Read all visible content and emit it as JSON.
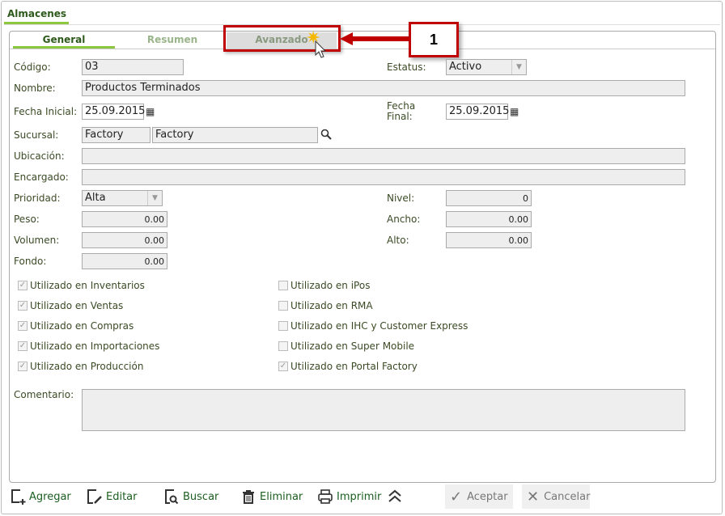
{
  "window_tab": "Almacenes",
  "tabs": [
    "General",
    "Resumen",
    "Avanzado"
  ],
  "callout": "1",
  "fields": {
    "codigo": {
      "label": "Código:",
      "value": "03"
    },
    "estatus": {
      "label": "Estatus:",
      "value": "Activo"
    },
    "nombre": {
      "label": "Nombre:",
      "value": "Productos Terminados"
    },
    "fecha_inicial": {
      "label": "Fecha Inicial:",
      "value": "25.09.2015"
    },
    "fecha_final": {
      "label": "Fecha Final:",
      "value": "25.09.2015"
    },
    "sucursal": {
      "label": "Sucursal:",
      "code": "Factory",
      "name": "Factory"
    },
    "ubicacion": {
      "label": "Ubicación:",
      "value": ""
    },
    "encargado": {
      "label": "Encargado:",
      "value": ""
    },
    "prioridad": {
      "label": "Prioridad:",
      "value": "Alta"
    },
    "nivel": {
      "label": "Nivel:",
      "value": "0"
    },
    "peso": {
      "label": "Peso:",
      "value": "0.00"
    },
    "ancho": {
      "label": "Ancho:",
      "value": "0.00"
    },
    "volumen": {
      "label": "Volumen:",
      "value": "0.00"
    },
    "alto": {
      "label": "Alto:",
      "value": "0.00"
    },
    "fondo": {
      "label": "Fondo:",
      "value": "0.00"
    },
    "comentario": {
      "label": "Comentario:",
      "value": ""
    }
  },
  "checks_left": [
    {
      "label": "Utilizado en Inventarios",
      "checked": true
    },
    {
      "label": "Utilizado en Ventas",
      "checked": true
    },
    {
      "label": "Utilizado en Compras",
      "checked": true
    },
    {
      "label": "Utilizado en Importaciones",
      "checked": true
    },
    {
      "label": "Utilizado en Producción",
      "checked": true
    }
  ],
  "checks_right": [
    {
      "label": "Utilizado en iPos",
      "checked": false
    },
    {
      "label": "Utilizado en RMA",
      "checked": false
    },
    {
      "label": "Utilizado en IHC y Customer Express",
      "checked": false
    },
    {
      "label": "Utilizado en Super Mobile",
      "checked": false
    },
    {
      "label": "Utilizado en Portal Factory",
      "checked": true
    }
  ],
  "toolbar": {
    "agregar": "Agregar",
    "editar": "Editar",
    "buscar": "Buscar",
    "eliminar": "Eliminar",
    "imprimir": "Imprimir",
    "aceptar": "Aceptar",
    "cancelar": "Cancelar"
  }
}
